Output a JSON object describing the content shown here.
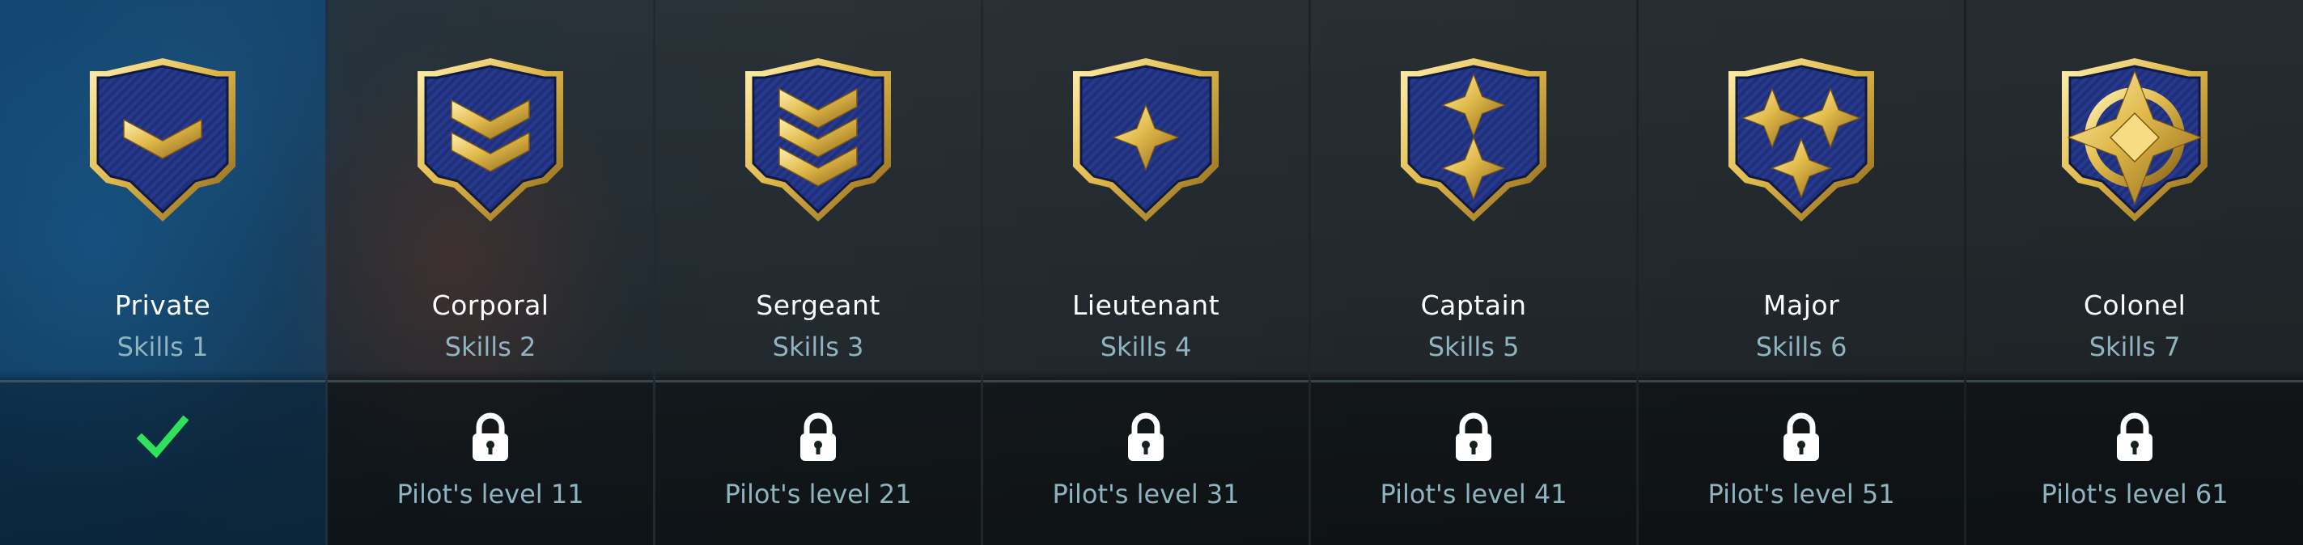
{
  "ranks": [
    {
      "name": "Private",
      "skills": "Skills 1",
      "status": "unlocked",
      "status_icon": "check-icon",
      "requirement": "",
      "insignia": "single-chevron"
    },
    {
      "name": "Corporal",
      "skills": "Skills 2",
      "status": "locked",
      "status_icon": "lock-icon",
      "requirement": "Pilot's level 11",
      "insignia": "double-chevron"
    },
    {
      "name": "Sergeant",
      "skills": "Skills 3",
      "status": "locked",
      "status_icon": "lock-icon",
      "requirement": "Pilot's level 21",
      "insignia": "triple-chevron"
    },
    {
      "name": "Lieutenant",
      "skills": "Skills 4",
      "status": "locked",
      "status_icon": "lock-icon",
      "requirement": "Pilot's level 31",
      "insignia": "single-star"
    },
    {
      "name": "Captain",
      "skills": "Skills 5",
      "status": "locked",
      "status_icon": "lock-icon",
      "requirement": "Pilot's level 41",
      "insignia": "double-star"
    },
    {
      "name": "Major",
      "skills": "Skills 6",
      "status": "locked",
      "status_icon": "lock-icon",
      "requirement": "Pilot's level 51",
      "insignia": "triple-star"
    },
    {
      "name": "Colonel",
      "skills": "Skills 7",
      "status": "locked",
      "status_icon": "lock-icon",
      "requirement": "Pilot's level 61",
      "insignia": "star-emblem"
    }
  ],
  "colors": {
    "badge_fill": "#1f2f7a",
    "badge_gold": "#e0b94a",
    "check_green": "#2ee35a",
    "lock_white": "#ffffff",
    "skills_text": "#8fb3bf"
  }
}
